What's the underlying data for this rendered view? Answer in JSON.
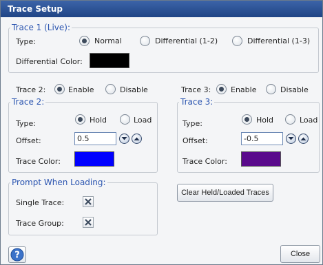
{
  "window": {
    "title": "Trace Setup"
  },
  "trace1": {
    "legend": "Trace 1 (Live):",
    "type_label": "Type:",
    "options": [
      "Normal",
      "Differential (1-2)",
      "Differential (1-3)"
    ],
    "selected": "Normal",
    "diff_color_label": "Differential Color:",
    "diff_color": "#000000"
  },
  "trace2_toggle": {
    "label": "Trace 2:",
    "enable": "Enable",
    "disable": "Disable",
    "selected": "Enable"
  },
  "trace3_toggle": {
    "label": "Trace 3:",
    "enable": "Enable",
    "disable": "Disable",
    "selected": "Enable"
  },
  "trace2": {
    "legend": "Trace 2:",
    "type_label": "Type:",
    "hold": "Hold",
    "load": "Load",
    "selected": "Hold",
    "offset_label": "Offset:",
    "offset_value": "0.5",
    "color_label": "Trace Color:",
    "color": "#0000ff"
  },
  "trace3": {
    "legend": "Trace 3:",
    "type_label": "Type:",
    "hold": "Hold",
    "load": "Load",
    "selected": "Hold",
    "offset_label": "Offset:",
    "offset_value": "-0.5",
    "color_label": "Trace Color:",
    "color": "#5a0a8c"
  },
  "prompt": {
    "legend": "Prompt When Loading:",
    "single_label": "Single Trace:",
    "group_label": "Trace Group:"
  },
  "buttons": {
    "clear": "Clear Held/Loaded Traces",
    "close": "Close"
  },
  "icons": {
    "help": "help-icon",
    "spin_down": "chevron-down-icon",
    "spin_up": "chevron-up-icon",
    "checkbox_x": "x-mark-icon"
  }
}
